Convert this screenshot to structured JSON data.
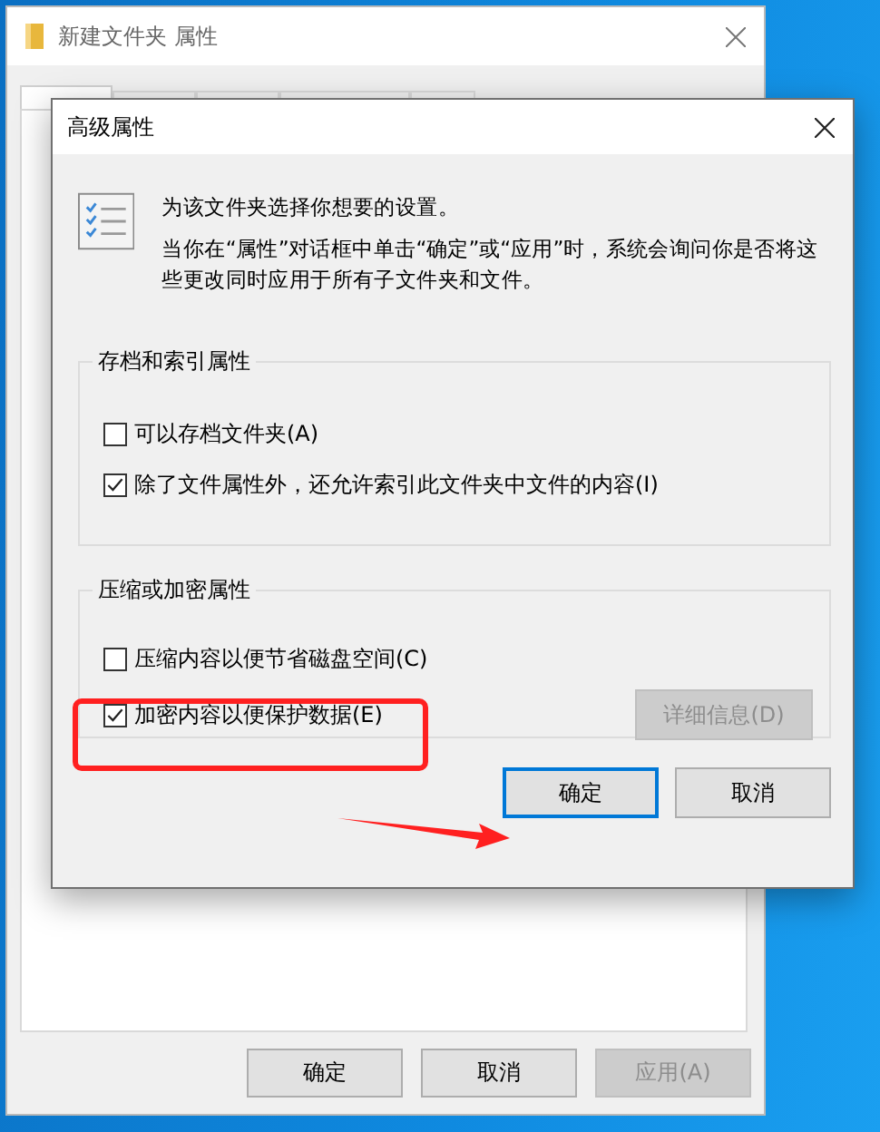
{
  "back_window": {
    "title": "新建文件夹 属性",
    "tabs": [
      {
        "selected": true
      },
      {
        "selected": false
      },
      {
        "selected": false
      },
      {
        "selected": false
      },
      {
        "selected": false
      }
    ],
    "buttons": [
      {
        "label": "确定",
        "disabled": false
      },
      {
        "label": "取消",
        "disabled": false
      },
      {
        "label": "应用(A)",
        "disabled": true
      }
    ]
  },
  "dialog": {
    "title": "高级属性",
    "intro": "为该文件夹选择你想要的设置。",
    "note": "当你在“属性”对话框中单击“确定”或“应用”时，系统会询问你是否将这些更改同时应用于所有子文件夹和文件。",
    "groups": [
      {
        "title": "存档和索引属性",
        "options": [
          {
            "label": "可以存档文件夹(A)",
            "checked": false
          },
          {
            "label": "除了文件属性外，还允许索引此文件夹中文件的内容(I)",
            "checked": true
          }
        ]
      },
      {
        "title": "压缩或加密属性",
        "options": [
          {
            "label": "压缩内容以便节省磁盘空间(C)",
            "checked": false
          },
          {
            "label": "加密内容以便保护数据(E)",
            "checked": true
          }
        ],
        "button": {
          "label": "详细信息(D)",
          "disabled": true
        }
      }
    ],
    "buttons": [
      {
        "label": "确定",
        "default": true
      },
      {
        "label": "取消",
        "default": false
      }
    ]
  }
}
